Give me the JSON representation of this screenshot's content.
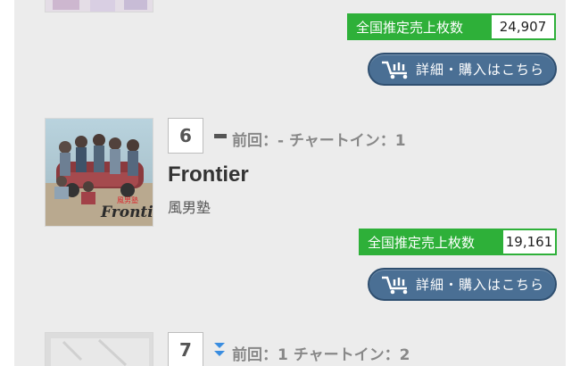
{
  "entries": [
    {
      "sales_label": "全国推定売上枚数",
      "sales_value": "24,907",
      "buy_label": "詳細・購入はこちら"
    },
    {
      "rank": "6",
      "movement": "flat",
      "prev_text": "前回：- チャートイン：1",
      "title": "Frontier",
      "artist": "風男塾",
      "jacket_title": "風男塾",
      "jacket_script": "Frontier",
      "sales_label": "全国推定売上枚数",
      "sales_value": "19,161",
      "buy_label": "詳細・購入はこちら"
    },
    {
      "rank": "7",
      "movement": "down",
      "prev_text": "前回：1 チャートイン：2"
    }
  ],
  "icons": {
    "cart": "cart-icon",
    "flat": "dash-icon",
    "down": "double-chevron-down-icon"
  },
  "colors": {
    "sales_green": "#2eb039",
    "button_blue": "#4a6f94",
    "down_arrow": "#3a8de0",
    "panel_bg": "#ececec"
  }
}
